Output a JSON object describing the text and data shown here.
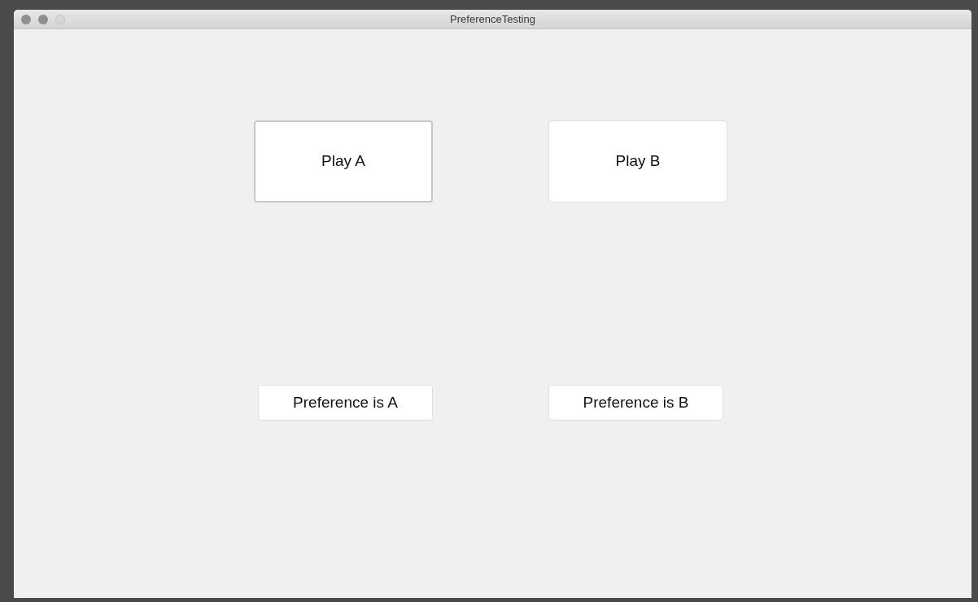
{
  "window": {
    "title": "PreferenceTesting"
  },
  "play_buttons": [
    {
      "label": "Play A",
      "focused": true
    },
    {
      "label": "Play B",
      "focused": false
    }
  ],
  "preference_buttons": [
    {
      "label": "Preference is A"
    },
    {
      "label": "Preference is B"
    }
  ]
}
